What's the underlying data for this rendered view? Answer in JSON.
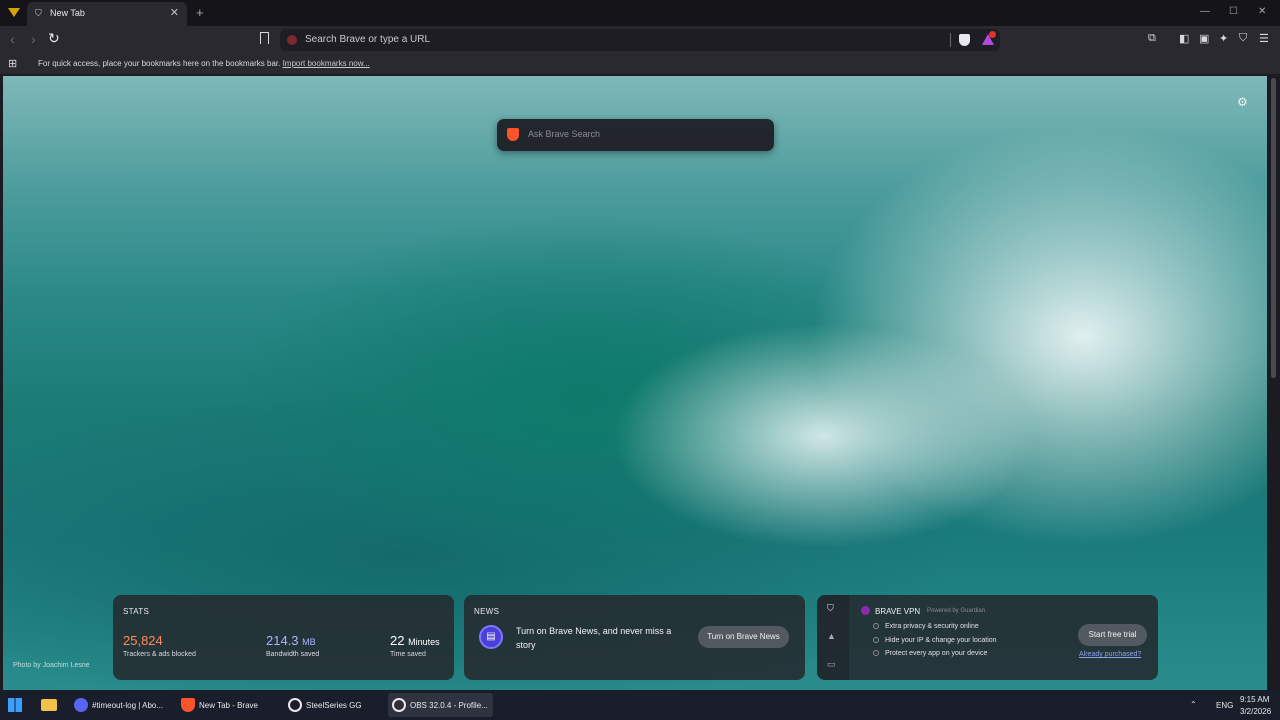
{
  "browser": {
    "tab_title": "New Tab",
    "tab_close": "✕",
    "new_tab": "+",
    "window_controls": [
      "—",
      "☐",
      "✕"
    ]
  },
  "toolbar": {
    "back": "‹",
    "forward": "›",
    "reload": "↻",
    "url_placeholder": "Search Brave or type a URL"
  },
  "bookmarks": {
    "message": "For quick access, place your bookmarks here on the bookmarks bar.",
    "import_link": "Import bookmarks now..."
  },
  "search": {
    "placeholder": "Ask Brave Search"
  },
  "photo_credit": "Photo by Joachim Lesne",
  "stats": {
    "title": "STATS",
    "trackers_value": "25,824",
    "trackers_label": "Trackers & ads blocked",
    "bandwidth_value": "214.3",
    "bandwidth_unit": "MB",
    "bandwidth_label": "Bandwidth saved",
    "time_value": "22",
    "time_unit": "Minutes",
    "time_label": "Time saved",
    "colors": {
      "trackers": "#ff8a5c",
      "bandwidth": "#a8b4ff",
      "time": "#ffffff"
    }
  },
  "news": {
    "title": "NEWS",
    "text": "Turn on Brave News, and never miss a story",
    "button": "Turn on Brave News"
  },
  "vpn": {
    "title": "BRAVE VPN",
    "powered_by": "Powered by Guardian",
    "features": [
      "Extra privacy & security online",
      "Hide your IP & change your location",
      "Protect every app on your device"
    ],
    "trial_button": "Start free trial",
    "purchased_link": "Already purchased?"
  },
  "taskbar": {
    "items": [
      "#timeout-log | Abo...",
      "New Tab - Brave",
      "SteelSeries GG",
      "OBS 32.0.4 - Profile..."
    ],
    "language": "ENG",
    "time": "9:15 AM",
    "date": "3/2/2026"
  }
}
